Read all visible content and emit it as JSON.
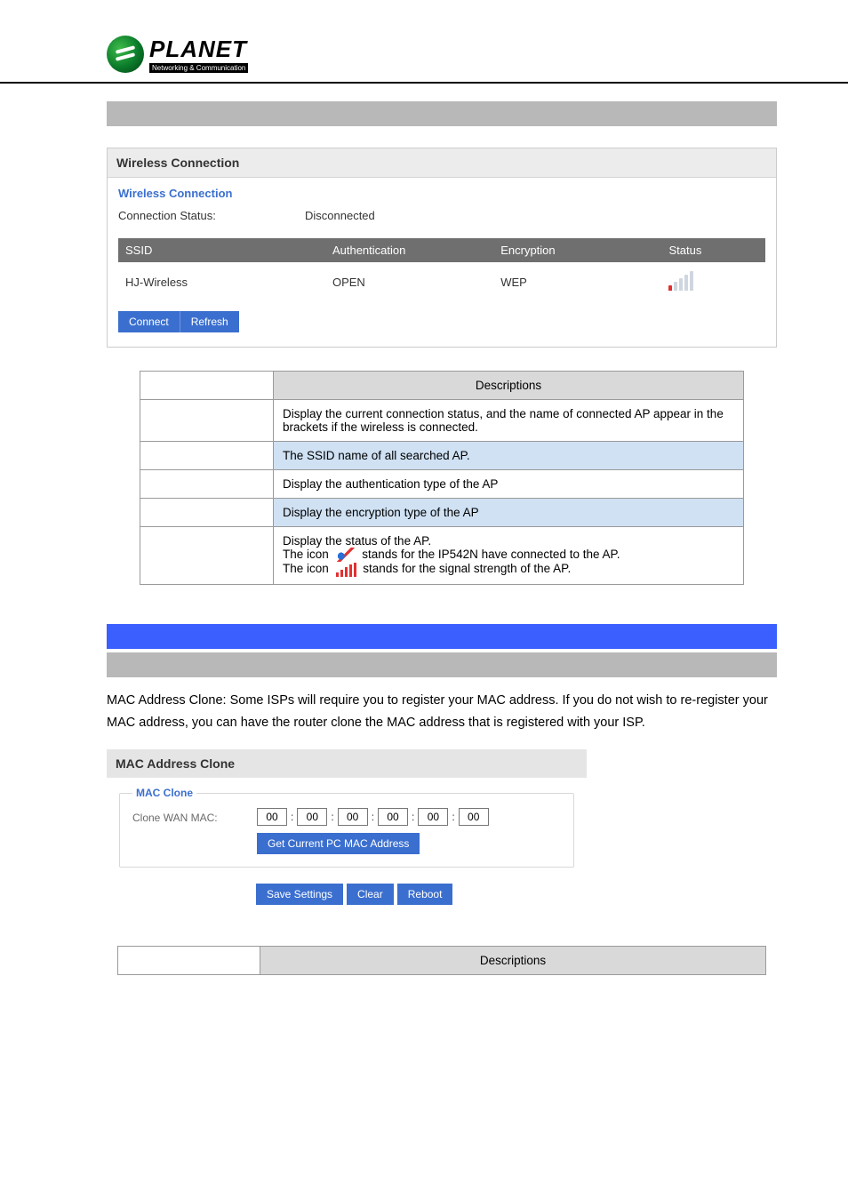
{
  "logo": {
    "brand": "PLANET",
    "tagline": "Networking & Communication"
  },
  "wireless_panel": {
    "title": "Wireless Connection",
    "fieldset_title": "Wireless Connection",
    "status_label": "Connection Status:",
    "status_value": "Disconnected",
    "columns": {
      "ssid": "SSID",
      "auth": "Authentication",
      "enc": "Encryption",
      "status": "Status"
    },
    "row": {
      "ssid": "HJ-Wireless",
      "auth": "OPEN",
      "enc": "WEP"
    },
    "buttons": {
      "connect": "Connect",
      "refresh": "Refresh"
    }
  },
  "desc1": {
    "header": "Descriptions",
    "rows": [
      {
        "value": "Display the current connection status, and the name of connected AP appear in the brackets if the wireless is connected."
      },
      {
        "value": "The SSID name of all searched AP.",
        "alt": true
      },
      {
        "value": "Display the authentication type of the AP"
      },
      {
        "value": "Display the encryption type of the AP",
        "alt": true
      }
    ],
    "status_row": {
      "l1": "Display the status of the AP.",
      "l2a": "The icon ",
      "l2b": " stands for the IP542N have connected to the AP.",
      "l3a": "The icon ",
      "l3b": " stands for the signal strength of the AP."
    }
  },
  "mac_section": {
    "body": "MAC Address Clone: Some ISPs will require you to register your MAC address. If you do not wish to re-register your MAC address, you can have the router clone the MAC address that is registered with your ISP.",
    "panel_title": "MAC Address Clone",
    "fieldset_title": "MAC Clone",
    "label": "Clone WAN MAC:",
    "octets": [
      "00",
      "00",
      "00",
      "00",
      "00",
      "00"
    ],
    "get_btn": "Get Current PC MAC Address",
    "save": "Save Settings",
    "clear": "Clear",
    "reboot": "Reboot"
  },
  "desc2": {
    "header": "Descriptions"
  }
}
